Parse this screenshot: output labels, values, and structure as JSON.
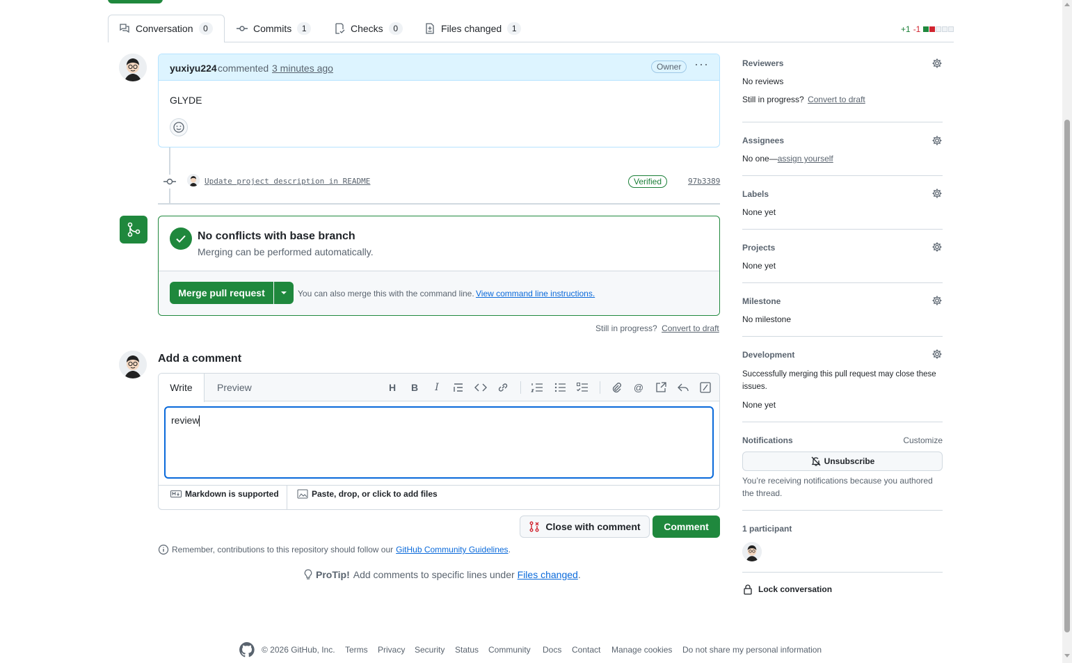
{
  "tabs": [
    {
      "label": "Conversation",
      "count": "0"
    },
    {
      "label": "Commits",
      "count": "1"
    },
    {
      "label": "Checks",
      "count": "0"
    },
    {
      "label": "Files changed",
      "count": "1"
    }
  ],
  "diffstat": {
    "added": "+1",
    "removed": "-1"
  },
  "comment": {
    "author": "yuxiyu224",
    "action": "commented",
    "time": "3 minutes ago",
    "role_badge": "Owner",
    "body": "GLYDE"
  },
  "commit": {
    "message": "Update project description in README",
    "badge": "Verified",
    "sha": "97b3389"
  },
  "merge": {
    "title": "No conflicts with base branch",
    "subtitle": "Merging can be performed automatically.",
    "button": "Merge pull request",
    "note": "You can also merge this with the command line.",
    "note_link": "View command line instructions."
  },
  "draft": {
    "text": "Still in progress?",
    "link": "Convert to draft"
  },
  "add_comment": {
    "title": "Add a comment",
    "tab_write": "Write",
    "tab_preview": "Preview",
    "value": "review",
    "markdown": "Markdown is supported",
    "attach": "Paste, drop, or click to add files",
    "close_button": "Close with comment",
    "comment_button": "Comment"
  },
  "guidelines": {
    "text": "Remember, contributions to this repository should follow our",
    "link": "GitHub Community Guidelines",
    "end": "."
  },
  "protip": {
    "label": "ProTip!",
    "text": "Add comments to specific lines under",
    "link": "Files changed",
    "end": "."
  },
  "sidebar": {
    "reviewers": {
      "title": "Reviewers",
      "value": "No reviews",
      "draft_text": "Still in progress?",
      "draft_link": "Convert to draft"
    },
    "assignees": {
      "title": "Assignees",
      "value": "No one—",
      "link": "assign yourself"
    },
    "labels": {
      "title": "Labels",
      "value": "None yet"
    },
    "projects": {
      "title": "Projects",
      "value": "None yet"
    },
    "milestone": {
      "title": "Milestone",
      "value": "No milestone"
    },
    "development": {
      "title": "Development",
      "desc": "Successfully merging this pull request may close these issues.",
      "value": "None yet"
    },
    "notifications": {
      "title": "Notifications",
      "customize": "Customize",
      "button": "Unsubscribe",
      "desc": "You’re receiving notifications because you authored the thread."
    },
    "participants": {
      "title": "1 participant"
    },
    "lock": "Lock conversation"
  },
  "footer": {
    "copyright": "© 2026 GitHub, Inc.",
    "links": [
      "Terms",
      "Privacy",
      "Security",
      "Status",
      "Community",
      "Docs",
      "Contact",
      "Manage cookies",
      "Do not share my personal information"
    ]
  },
  "colors": {
    "green": "#1f883d",
    "blue_link": "#0969da",
    "header_bg": "#ddf4ff",
    "border": "#d1d9e0"
  }
}
